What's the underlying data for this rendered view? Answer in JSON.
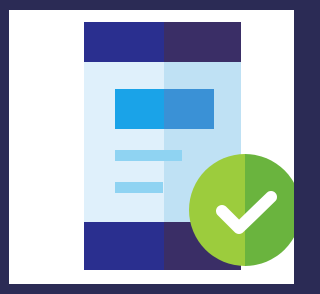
{
  "icon": {
    "name": "mobile-app-verified-icon",
    "colors": {
      "frame_background": "#2b2b55",
      "card_background": "#ffffff",
      "phone_header_left": "#2a2f8f",
      "phone_header_right": "#3a2e66",
      "phone_screen_left": "#dff0fb",
      "phone_screen_right": "#bfe1f4",
      "content_block_left": "#1aa3e8",
      "content_block_right": "#3a91d6",
      "text_lines": "#8fd3f2",
      "check_badge_left": "#9ccc3d",
      "check_badge_right": "#6ab43e",
      "checkmark": "#ffffff"
    }
  }
}
